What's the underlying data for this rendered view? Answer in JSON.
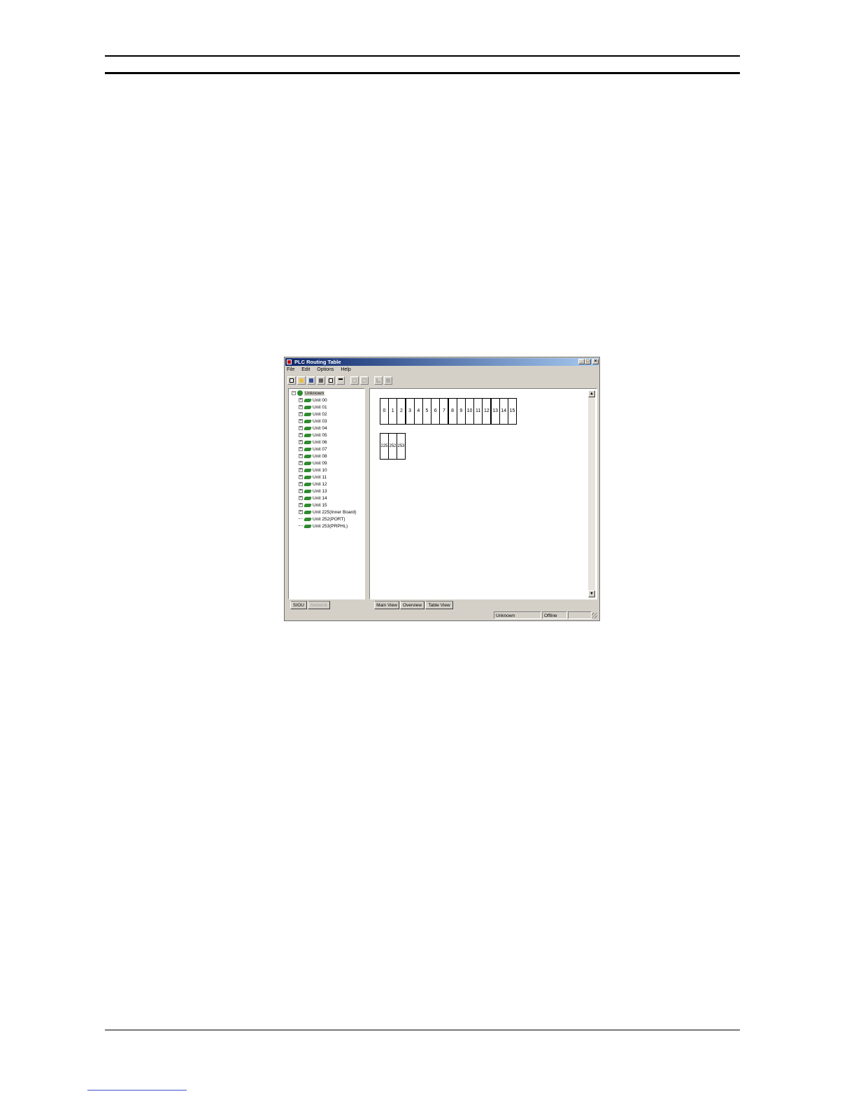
{
  "window": {
    "title": "PLC Routing Table",
    "caption_buttons": {
      "minimize": "_",
      "maximize": "□",
      "close": "×"
    }
  },
  "menu": [
    "File",
    "Edit",
    "Options",
    "Help"
  ],
  "toolbar": {
    "icons": [
      "new-icon",
      "open-icon",
      "save-icon",
      "print-icon",
      "print-preview-icon",
      "insert-icon",
      "font-icon",
      "undo-icon",
      "check-icon",
      "transfer-icon"
    ]
  },
  "tree": {
    "root": "Unknown",
    "items": [
      "Unit 00",
      "Unit 01",
      "Unit 02",
      "Unit 03",
      "Unit 04",
      "Unit 05",
      "Unit 06",
      "Unit 07",
      "Unit 08",
      "Unit 09",
      "Unit 10",
      "Unit 11",
      "Unit 12",
      "Unit 13",
      "Unit 14",
      "Unit 15",
      "Unit 225(Inner Board)",
      "Unit 252(PORT)",
      "Unit 253(PRPHL)"
    ]
  },
  "main_view": {
    "slots_row1": [
      "0",
      "1",
      "2",
      "3",
      "4",
      "5",
      "6",
      "7",
      "8",
      "9",
      "10",
      "11",
      "12",
      "13",
      "14",
      "15"
    ],
    "slots_row2": [
      "225",
      "252",
      "253"
    ]
  },
  "left_tabs": [
    "SIOU",
    "Network"
  ],
  "view_tabs": [
    "Main View",
    "Overview",
    "Table View"
  ],
  "status": {
    "model": "Unknown",
    "mode": "Offline",
    "extra": ""
  },
  "colors": {
    "title_start": "#0a246a",
    "title_end": "#a6caf0",
    "unit_icon": "#2e8b2e"
  }
}
